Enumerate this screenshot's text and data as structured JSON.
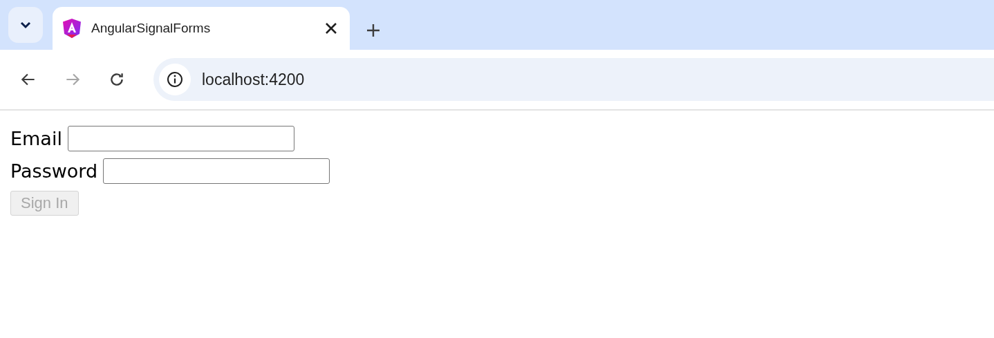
{
  "browser": {
    "tab": {
      "title": "AngularSignalForms",
      "selected": true
    },
    "nav_buttons": [
      {
        "kind": "back",
        "disabled": false
      },
      {
        "kind": "forward",
        "disabled": true
      },
      {
        "kind": "reload",
        "disabled": false
      }
    ],
    "address": "localhost:4200"
  },
  "form": {
    "fields": [
      {
        "label": "Email"
      },
      {
        "label": "Password"
      }
    ],
    "submit": {
      "label": "Sign In",
      "disabled": true
    }
  }
}
